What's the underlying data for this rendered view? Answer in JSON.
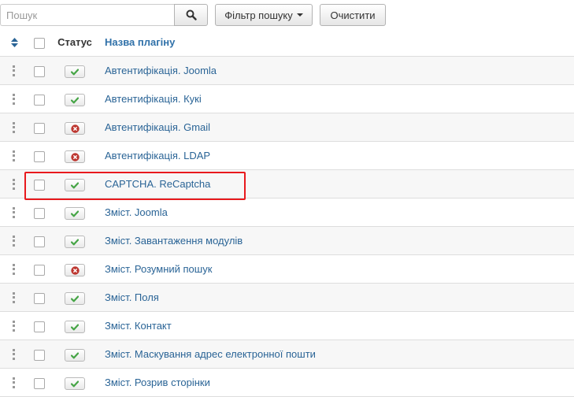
{
  "toolbar": {
    "search_placeholder": "Пошук",
    "search_value": "",
    "search_icon": "search-icon",
    "filter_label": "Фільтр пошуку",
    "clear_label": "Очистити"
  },
  "table": {
    "headers": {
      "status": "Статус",
      "name": "Назва плагіну"
    },
    "rows": [
      {
        "name": "Автентифікація. Joomla",
        "status": "enabled"
      },
      {
        "name": "Автентифікація. Кукі",
        "status": "enabled"
      },
      {
        "name": "Автентифікація. Gmail",
        "status": "disabled"
      },
      {
        "name": "Автентифікація. LDAP",
        "status": "disabled"
      },
      {
        "name": "CAPTCHA. ReCaptcha",
        "status": "enabled"
      },
      {
        "name": "Зміст. Joomla",
        "status": "enabled"
      },
      {
        "name": "Зміст. Завантаження модулів",
        "status": "enabled"
      },
      {
        "name": "Зміст. Розумний пошук",
        "status": "disabled"
      },
      {
        "name": "Зміст. Поля",
        "status": "enabled"
      },
      {
        "name": "Зміст. Контакт",
        "status": "enabled"
      },
      {
        "name": "Зміст. Маскування адрес електронної пошти",
        "status": "enabled"
      },
      {
        "name": "Зміст. Розрив сторінки",
        "status": "enabled"
      }
    ]
  },
  "highlighted_row_index": 4,
  "colors": {
    "link": "#2a6496",
    "enabled": "#46a546",
    "disabled": "#bd362f",
    "highlight": "#e8191d"
  }
}
